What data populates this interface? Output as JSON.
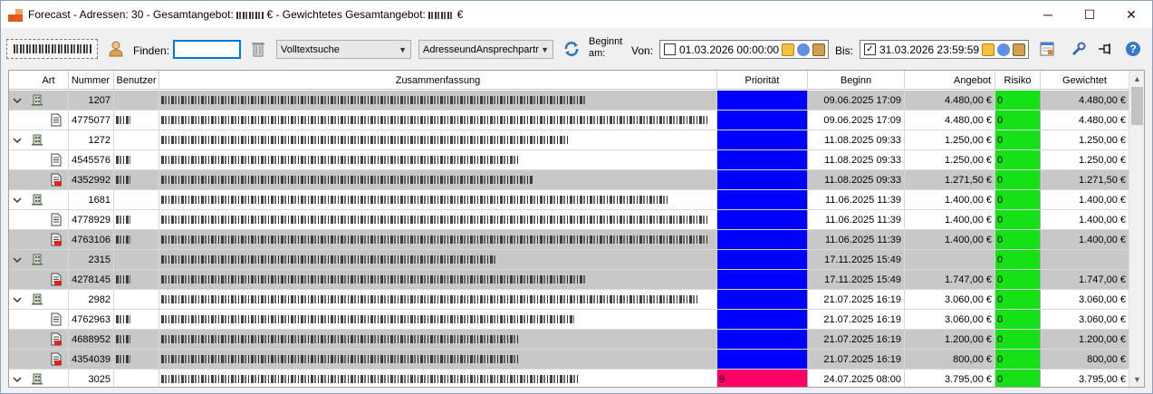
{
  "window": {
    "title_prefix": "Forecast - Adressen: 30 - Gesamtangebot:",
    "title_euro1": "€ - Gewichtetes Gesamtangebot:",
    "title_euro2": "€",
    "minimize": "─",
    "maximize": "☐",
    "close": "✕"
  },
  "toolbar": {
    "find_label": "Finden:",
    "find_value": "",
    "search_mode": "Volltextsuche",
    "search_field": "AdresseundAnsprechpartr",
    "begins_label": "Beginnt am:",
    "from_label": "Von:",
    "from_checked": false,
    "from_value": "01.03.2026 00:00:00",
    "to_label": "Bis:",
    "to_checked": true,
    "to_value": "31.03.2026 23:59:59"
  },
  "colors": {
    "priority_blue": "#0000ff",
    "priority_pink": "#ff0066",
    "risk_green": "#16e016",
    "row_gray": "#c8c8c8"
  },
  "table": {
    "columns": [
      "Art",
      "Nummer",
      "Benutzer",
      "Zusammenfassung",
      "Priorität",
      "Beginn",
      "Angebot",
      "Risiko",
      "Gewichtet"
    ],
    "rows": [
      {
        "level": 0,
        "icon": "building-icon",
        "nummer": "1207",
        "prio": "",
        "prio_color": "blue",
        "beginn": "09.06.2025 17:09",
        "angebot": "4.480,00 €",
        "risiko": "0",
        "gewichtet": "4.480,00 €",
        "gray": true
      },
      {
        "level": 1,
        "icon": "document-icon",
        "nummer": "4775077",
        "prio": "",
        "prio_color": "blue",
        "beginn": "09.06.2025 17:09",
        "angebot": "4.480,00 €",
        "risiko": "0",
        "gewichtet": "4.480,00 €",
        "gray": false
      },
      {
        "level": 0,
        "icon": "building-icon",
        "nummer": "1272",
        "prio": "",
        "prio_color": "blue",
        "beginn": "11.08.2025 09:33",
        "angebot": "1.250,00 €",
        "risiko": "0",
        "gewichtet": "1.250,00 €",
        "gray": false
      },
      {
        "level": 1,
        "icon": "document-icon",
        "nummer": "4545576",
        "prio": "",
        "prio_color": "blue",
        "beginn": "11.08.2025 09:33",
        "angebot": "1.250,00 €",
        "risiko": "0",
        "gewichtet": "1.250,00 €",
        "gray": false
      },
      {
        "level": 1,
        "icon": "document-red-icon",
        "nummer": "4352992",
        "prio": "",
        "prio_color": "blue",
        "beginn": "11.08.2025 09:33",
        "angebot": "1.271,50 €",
        "risiko": "0",
        "gewichtet": "1.271,50 €",
        "gray": true
      },
      {
        "level": 0,
        "icon": "building-icon",
        "nummer": "1681",
        "prio": "",
        "prio_color": "blue",
        "beginn": "11.06.2025 11:39",
        "angebot": "1.400,00 €",
        "risiko": "0",
        "gewichtet": "1.400,00 €",
        "gray": false
      },
      {
        "level": 1,
        "icon": "document-icon",
        "nummer": "4778929",
        "prio": "",
        "prio_color": "blue",
        "beginn": "11.06.2025 11:39",
        "angebot": "1.400,00 €",
        "risiko": "0",
        "gewichtet": "1.400,00 €",
        "gray": false
      },
      {
        "level": 1,
        "icon": "document-red-icon",
        "nummer": "4763106",
        "prio": "",
        "prio_color": "blue",
        "beginn": "11.06.2025 11:39",
        "angebot": "1.400,00 €",
        "risiko": "0",
        "gewichtet": "1.400,00 €",
        "gray": true
      },
      {
        "level": 0,
        "icon": "building-icon",
        "nummer": "2315",
        "prio": "",
        "prio_color": "blue",
        "beginn": "17.11.2025 15:49",
        "angebot": "",
        "risiko": "0",
        "gewichtet": "",
        "gray": true
      },
      {
        "level": 1,
        "icon": "document-red-icon",
        "nummer": "4278145",
        "prio": "",
        "prio_color": "blue",
        "beginn": "17.11.2025 15:49",
        "angebot": "1.747,00 €",
        "risiko": "0",
        "gewichtet": "1.747,00 €",
        "gray": true
      },
      {
        "level": 0,
        "icon": "building-icon",
        "nummer": "2982",
        "prio": "",
        "prio_color": "blue",
        "beginn": "21.07.2025 16:19",
        "angebot": "3.060,00 €",
        "risiko": "0",
        "gewichtet": "3.060,00 €",
        "gray": false
      },
      {
        "level": 1,
        "icon": "document-icon",
        "nummer": "4762963",
        "prio": "",
        "prio_color": "blue",
        "beginn": "21.07.2025 16:19",
        "angebot": "3.060,00 €",
        "risiko": "0",
        "gewichtet": "3.060,00 €",
        "gray": false
      },
      {
        "level": 1,
        "icon": "document-red-icon",
        "nummer": "4688952",
        "prio": "",
        "prio_color": "blue",
        "beginn": "21.07.2025 16:19",
        "angebot": "1.200,00 €",
        "risiko": "0",
        "gewichtet": "1.200,00 €",
        "gray": true
      },
      {
        "level": 1,
        "icon": "document-red-icon",
        "nummer": "4354039",
        "prio": "",
        "prio_color": "blue",
        "beginn": "21.07.2025 16:19",
        "angebot": "800,00 €",
        "risiko": "0",
        "gewichtet": "800,00 €",
        "gray": true
      },
      {
        "level": 0,
        "icon": "building-icon",
        "nummer": "3025",
        "prio": "9",
        "prio_color": "pink",
        "beginn": "24.07.2025 08:00",
        "angebot": "3.795,00 €",
        "risiko": "0",
        "gewichtet": "3.795,00 €",
        "gray": false
      }
    ]
  }
}
